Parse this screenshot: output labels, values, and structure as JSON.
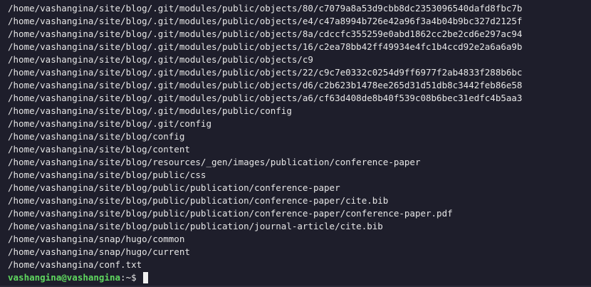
{
  "terminal": {
    "lines": [
      "/home/vashangina/site/blog/.git/modules/public/objects/80/c7079a8a53d9cbb8dc2353096540dafd8fbc7b",
      "/home/vashangina/site/blog/.git/modules/public/objects/e4/c47a8994b726e42a96f3a4b04b9bc327d2125f",
      "/home/vashangina/site/blog/.git/modules/public/objects/8a/cdccfc355259e0abd1862cc2be2cd6e297ac94",
      "/home/vashangina/site/blog/.git/modules/public/objects/16/c2ea78bb42ff49934e4fc1b4ccd92e2a6a6a9b",
      "/home/vashangina/site/blog/.git/modules/public/objects/c9",
      "/home/vashangina/site/blog/.git/modules/public/objects/22/c9c7e0332c0254d9ff6977f2ab4833f288b6bc",
      "/home/vashangina/site/blog/.git/modules/public/objects/d6/c2b623b1478ee265d31d51db8c3442feb86e58",
      "/home/vashangina/site/blog/.git/modules/public/objects/a6/cf63d408de8b40f539c08b6bec31edfc4b5aa3",
      "/home/vashangina/site/blog/.git/modules/public/config",
      "/home/vashangina/site/blog/.git/config",
      "/home/vashangina/site/blog/config",
      "/home/vashangina/site/blog/content",
      "/home/vashangina/site/blog/resources/_gen/images/publication/conference-paper",
      "/home/vashangina/site/blog/public/css",
      "/home/vashangina/site/blog/public/publication/conference-paper",
      "/home/vashangina/site/blog/public/publication/conference-paper/cite.bib",
      "/home/vashangina/site/blog/public/publication/conference-paper/conference-paper.pdf",
      "/home/vashangina/site/blog/public/publication/journal-article/cite.bib",
      "/home/vashangina/snap/hugo/common",
      "/home/vashangina/snap/hugo/current",
      "/home/vashangina/conf.txt"
    ],
    "prompt": {
      "user_host": "vashangina@vashangina",
      "separator": ":",
      "path": "~",
      "symbol": "$ "
    }
  },
  "colors": {
    "background": "#1e1e2b",
    "text": "#e6e6e6",
    "prompt_user": "#5fd75f",
    "cursor": "#f0f0f0"
  }
}
